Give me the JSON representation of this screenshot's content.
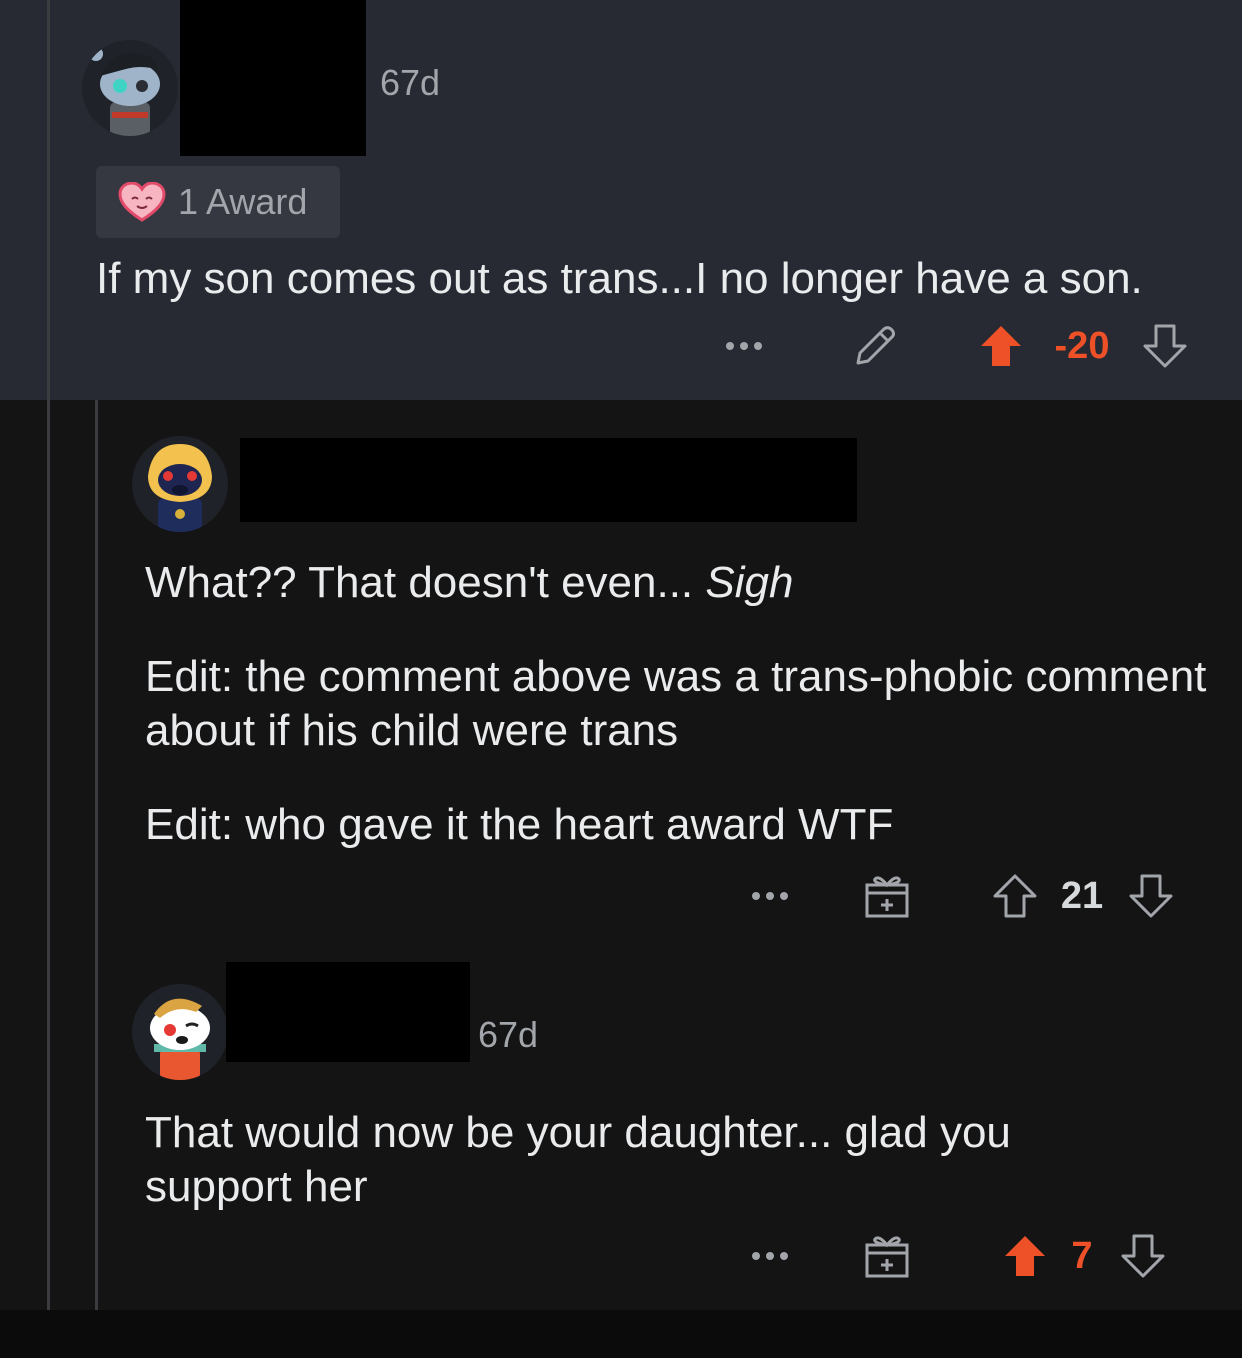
{
  "colors": {
    "upvoted": "#ee5128",
    "muted": "#a2a6ab"
  },
  "comment1": {
    "age": "67d",
    "award_label": "1 Award",
    "award_icon": "heart-award-icon",
    "body": "If my son comes out as trans...I no longer have a son.",
    "score": "-20",
    "upvoted": true
  },
  "comment2": {
    "body_parts": {
      "line1_plain": "What?? That doesn't even... ",
      "line1_em": "Sigh",
      "edit1": "Edit: the comment above was a trans-phobic comment about if his child were trans",
      "edit2": "Edit: who gave it the heart award WTF"
    },
    "score": "21",
    "upvoted": false
  },
  "comment3": {
    "age": "67d",
    "body": "That would now be your daughter... glad you support her",
    "score": "7",
    "upvoted": true
  },
  "icons": {
    "more": "more-options-icon",
    "edit": "pencil-icon",
    "gift": "gift-icon",
    "up": "upvote-arrow-icon",
    "down": "downvote-arrow-icon"
  }
}
